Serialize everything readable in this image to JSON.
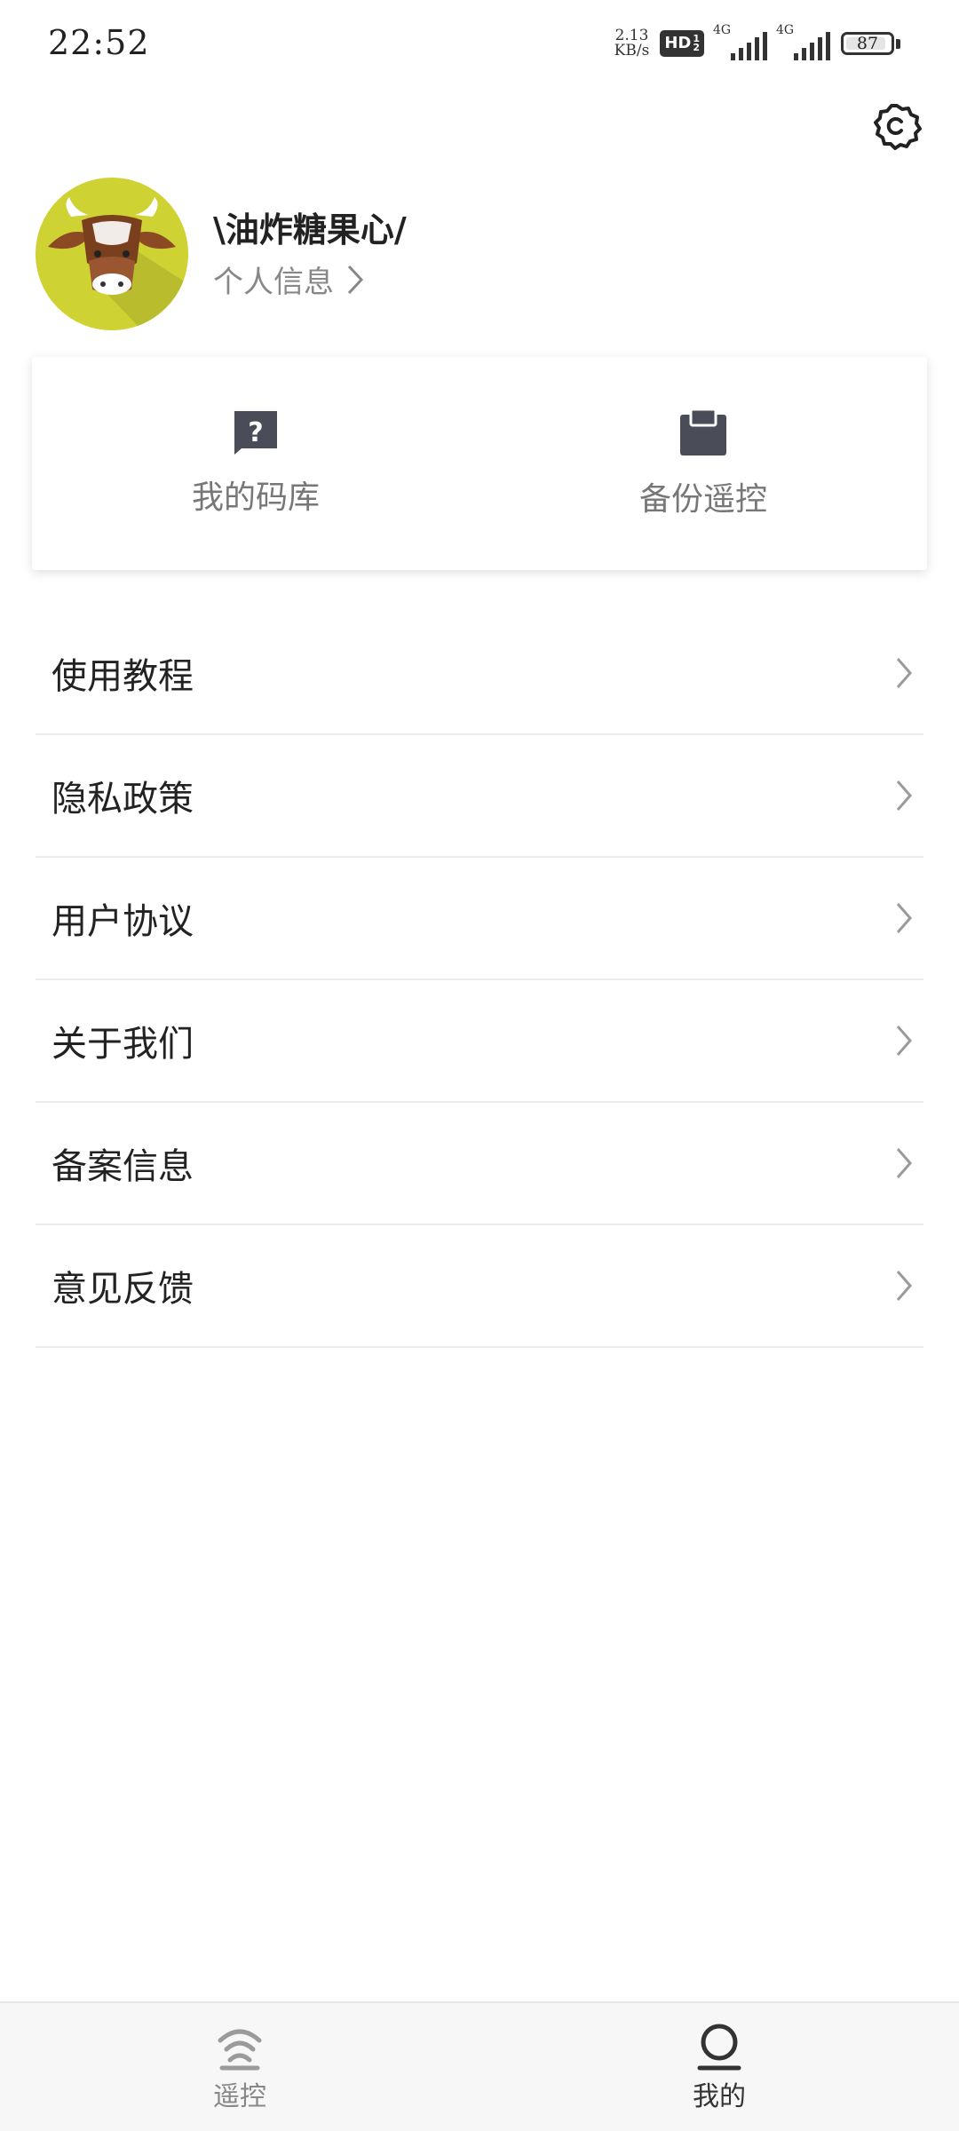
{
  "status_bar": {
    "time": "22:52",
    "speed_value": "2.13",
    "speed_unit": "KB/s",
    "hd_label": "HD",
    "network_1": "4G",
    "network_2": "4G",
    "battery": "87"
  },
  "header": {
    "settings_icon": "gear-icon"
  },
  "profile": {
    "username": "\\油炸糖果心/",
    "info_link": "个人信息"
  },
  "quick_actions": [
    {
      "label": "我的码库",
      "icon": "question-doc-icon"
    },
    {
      "label": "备份遥控",
      "icon": "clipboard-icon"
    }
  ],
  "menu": {
    "items": [
      {
        "label": "使用教程"
      },
      {
        "label": "隐私政策"
      },
      {
        "label": "用户协议"
      },
      {
        "label": "关于我们"
      },
      {
        "label": "备案信息"
      },
      {
        "label": "意见反馈"
      }
    ]
  },
  "bottom_nav": {
    "items": [
      {
        "label": "遥控",
        "icon": "remote-signal-icon",
        "active": false
      },
      {
        "label": "我的",
        "icon": "user-icon",
        "active": true
      }
    ]
  },
  "colors": {
    "avatar_bg": "#cfd233",
    "icon_dark": "#4a4d57",
    "text_primary": "#222222",
    "text_secondary": "#888888"
  }
}
